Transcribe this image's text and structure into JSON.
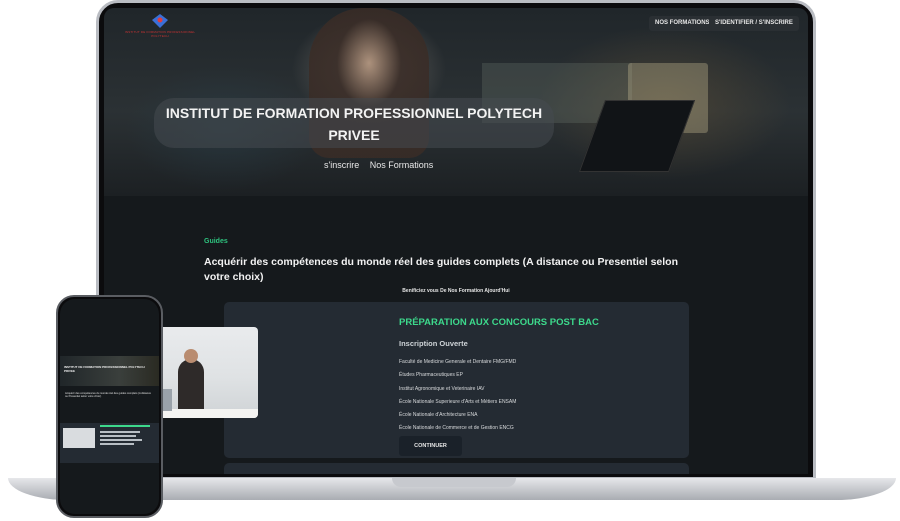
{
  "header": {
    "logo_text": "INSTITUT DE FORMATION PROFESSIONNEL POLYTECH",
    "nav": [
      {
        "label": "NOS FORMATIONS"
      },
      {
        "label": "S'IDENTIFIER / S'INSCRIRE"
      }
    ]
  },
  "hero": {
    "title": "INSTITUT DE FORMATION PROFESSIONNEL POLYTECH PRIVEE",
    "links": [
      "s'inscrire",
      "Nos Formations"
    ]
  },
  "guides": {
    "label": "Guides",
    "heading": "Acquérir des compétences du monde réel des guides complets (A distance ou Presentiel selon votre choix)",
    "benefit": "Benificiez vous De Nos Formation Ajourd'Hui"
  },
  "card": {
    "title": "PRÉPARATION AUX CONCOURS POST BAC",
    "subtitle": "Inscription Ouverte",
    "items": [
      "Faculté de Medicine Generale et Dentaire FMG/FMD",
      "Études Pharmaceutiques EP",
      "Institut Agronomique et Veterinaire IAV",
      "École Nationale Superieure d'Arts et Métiers ENSAM",
      "École Nationale d'Architecture ENA",
      "École Nationale de Commerce et de Gestion ENCG"
    ],
    "cta": "CONTINUER"
  },
  "phone": {
    "hero_title": "INSTITUT DE FORMATION PROFESSIONNEL POLYTECH PRIVEE",
    "heading": "Acquérir des compétences du monde réel des guides complets (A distance ou Presentiel selon votre choix)"
  }
}
